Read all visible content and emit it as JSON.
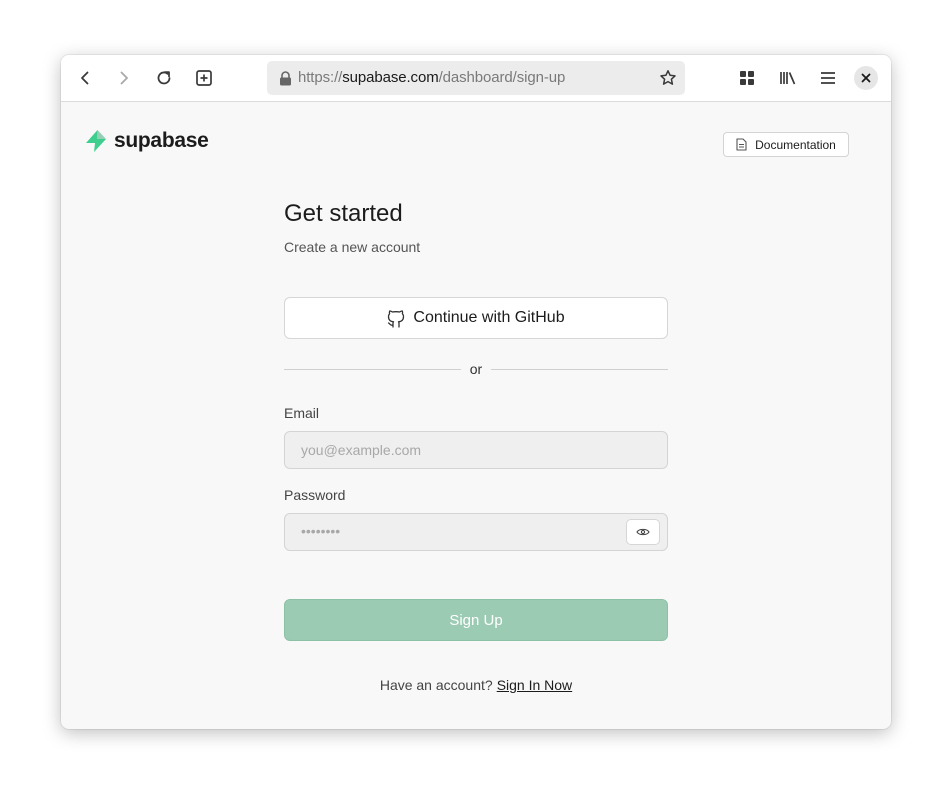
{
  "browser": {
    "url_scheme": "https://",
    "url_host": "supabase.com",
    "url_path": "/dashboard/sign-up",
    "icons": [
      "back-icon",
      "forward-icon",
      "reload-icon",
      "new-tab-icon",
      "lock-icon",
      "star-icon",
      "extensions-icon",
      "library-icon",
      "menu-icon",
      "close-icon"
    ]
  },
  "header": {
    "logo_text": "supabase",
    "doc_button_label": "Documentation"
  },
  "form": {
    "title": "Get started",
    "subtitle": "Create a new account",
    "github_button_label": "Continue with GitHub",
    "divider_text": "or",
    "email_label": "Email",
    "email_placeholder": "you@example.com",
    "email_value": "",
    "password_label": "Password",
    "password_value_masked": "••••••••",
    "signup_button_label": "Sign Up",
    "footer_text": "Have an account?",
    "signin_link_label": "Sign In Now"
  },
  "colors": {
    "brand_green": "#3ecf8e",
    "signup_button_bg": "#9ccbb3"
  }
}
